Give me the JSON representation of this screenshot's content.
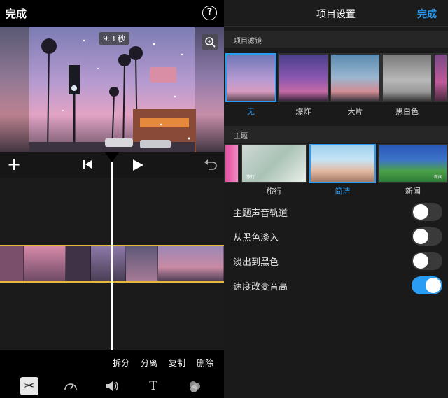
{
  "editor": {
    "done_label": "完成",
    "help_icon": "?",
    "timecode": "9.3 秒",
    "actions": [
      "拆分",
      "分离",
      "复制",
      "删除"
    ],
    "tools": [
      "scissors-icon",
      "speed-icon",
      "volume-icon",
      "title-icon",
      "filter-icon"
    ]
  },
  "settings": {
    "title": "项目设置",
    "done_label": "完成",
    "filters_section": "项目滤镜",
    "filters": [
      "无",
      "爆炸",
      "大片",
      "黑白色"
    ],
    "selected_filter": "无",
    "themes_section": "主题",
    "themes": [
      "旅行",
      "简洁",
      "新闻"
    ],
    "selected_theme": "简洁",
    "theme_captions": {
      "travel": "旅行",
      "news": "新闻"
    },
    "toggles": [
      {
        "label": "主题声音轨道",
        "on": false
      },
      {
        "label": "从黑色淡入",
        "on": false
      },
      {
        "label": "淡出到黑色",
        "on": false
      },
      {
        "label": "速度改变音高",
        "on": true
      }
    ],
    "accent_color": "#2b9cf3"
  }
}
